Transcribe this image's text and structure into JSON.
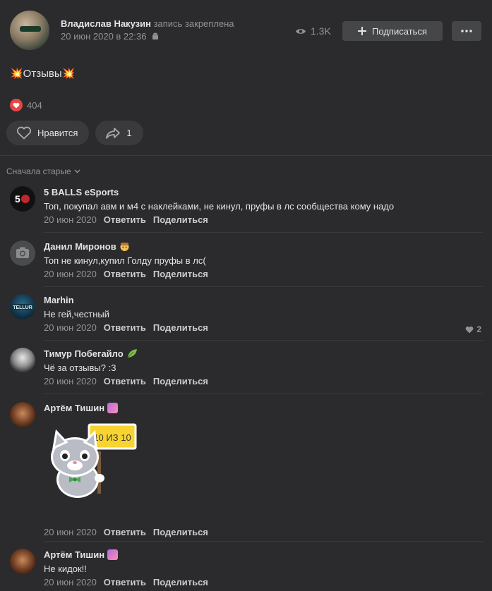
{
  "post": {
    "author": "Владислав Накузин",
    "pinned": "запись закреплена",
    "date": "20 июн 2020 в 22:36",
    "views": "1.3K",
    "subscribe_label": "Подписаться",
    "text": "💥Отзывы💥",
    "likes_total": "404",
    "like_label": "Нравится",
    "share_count": "1"
  },
  "sort_label": "Сначала старые",
  "comments": [
    {
      "author": "5 BALLS eSports",
      "text": "Топ, покупал авм и м4 с наклейками, не кинул, пруфы в лс сообщества кому надо",
      "date": "20 июн 2020",
      "reply": "Ответить",
      "share": "Поделиться"
    },
    {
      "author": "Данил Миронов",
      "text": "Топ не кинул,купил Голду пруфы в лс(",
      "date": "20 июн 2020",
      "reply": "Ответить",
      "share": "Поделиться"
    },
    {
      "author": "Marhin",
      "text": "Не гей,честный",
      "date": "20 июн 2020",
      "reply": "Ответить",
      "share": "Поделиться",
      "likes": "2",
      "avatar_text": "TELLUR"
    },
    {
      "author": "Тимур Побегайло",
      "text": "Чё за отзывы? :3",
      "date": "20 июн 2020",
      "reply": "Ответить",
      "share": "Поделиться"
    },
    {
      "author": "Артём Тишин",
      "date": "20 июн 2020",
      "reply": "Ответить",
      "share": "Поделиться",
      "sticker_text": "10 ИЗ 10"
    },
    {
      "author": "Артём Тишин",
      "text": "Не кидок!!",
      "date": "20 июн 2020",
      "reply": "Ответить",
      "share": "Поделиться"
    }
  ]
}
